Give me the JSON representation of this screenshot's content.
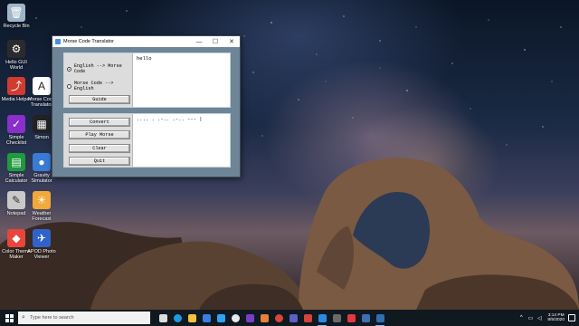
{
  "desktop": {
    "icons": [
      {
        "label": "Recycle Bin",
        "icon": "recycle-bin-icon",
        "color": "#9fb6c8",
        "glyph": "🗑"
      },
      {
        "label": "Hello GUI World",
        "icon": "python-app-icon",
        "color": "#2b2b2b",
        "glyph": "⚙"
      },
      {
        "label": "Media Helper",
        "icon": "media-helper-icon",
        "color": "#d23b2f",
        "glyph": "⤴"
      },
      {
        "label": "Morse Code Translator",
        "icon": "morse-translator-icon",
        "color": "#ffffff",
        "glyph": "A"
      },
      {
        "label": "Simple Checklist",
        "icon": "checklist-icon",
        "color": "#8a2fc9",
        "glyph": "✓"
      },
      {
        "label": "Simon",
        "icon": "simon-game-icon",
        "color": "#222222",
        "glyph": "▦"
      },
      {
        "label": "Simple Calculator",
        "icon": "calculator-icon",
        "color": "#1f9a3d",
        "glyph": "▤"
      },
      {
        "label": "Gravity Simulator",
        "icon": "gravity-simulator-icon",
        "color": "#3a7bd5",
        "glyph": "●"
      },
      {
        "label": "Notepad",
        "icon": "notepad-icon",
        "color": "#c9c9c9",
        "glyph": "✎"
      },
      {
        "label": "Weather Forecast",
        "icon": "weather-forecast-icon",
        "color": "#f2a93b",
        "glyph": "☀"
      },
      {
        "label": "Color Theme Maker",
        "icon": "color-theme-icon",
        "color": "#e8453c",
        "glyph": "◆"
      },
      {
        "label": "APOD Photo Viewer",
        "icon": "apod-rocket-icon",
        "color": "#2f63c9",
        "glyph": "✈"
      }
    ]
  },
  "window": {
    "title": "Morse Code Translator",
    "minimize_symbol": "—",
    "maximize_symbol": "☐",
    "close_symbol": "✕",
    "radio_english_to_morse": "English --> Morse Code",
    "radio_morse_to_english": "Morse Code --> English",
    "guide_label": "Guide",
    "input_text": "hello",
    "output_text": ".... . .-.. .-.. --- |",
    "convert_label": "Convert",
    "play_morse_label": "Play Morse",
    "clear_label": "Clear",
    "quit_label": "Quit",
    "selected_mode": "English --> Morse Code"
  },
  "taskbar": {
    "search_placeholder": "Type here to search",
    "apps": [
      {
        "icon": "task-view-icon",
        "color": "#dcdcdc"
      },
      {
        "icon": "edge-browser-icon",
        "color": "#1e9be0"
      },
      {
        "icon": "file-explorer-icon",
        "color": "#f3c23d"
      },
      {
        "icon": "store-icon",
        "color": "#3b7de0"
      },
      {
        "icon": "photos-icon",
        "color": "#2ea3f2"
      },
      {
        "icon": "media-player-icon",
        "color": "#e9e9e9"
      },
      {
        "icon": "onenote-icon",
        "color": "#7a3ec4"
      },
      {
        "icon": "photo-app-icon",
        "color": "#e8803a"
      },
      {
        "icon": "chrome-icon",
        "color": "#db4437"
      },
      {
        "icon": "teams-icon",
        "color": "#5b5fc7"
      },
      {
        "icon": "app-icon",
        "color": "#d4453a"
      },
      {
        "icon": "vscode-icon",
        "color": "#2b8be0"
      },
      {
        "icon": "file-manager-icon",
        "color": "#6a6a6a"
      },
      {
        "icon": "pdf-icon",
        "color": "#e23b3b"
      },
      {
        "icon": "terminal-icon",
        "color": "#3d6fb5"
      },
      {
        "icon": "python-idle-icon",
        "color": "#2f6fb3"
      }
    ],
    "time": "3:14 PM",
    "date": "8/5/2020"
  }
}
